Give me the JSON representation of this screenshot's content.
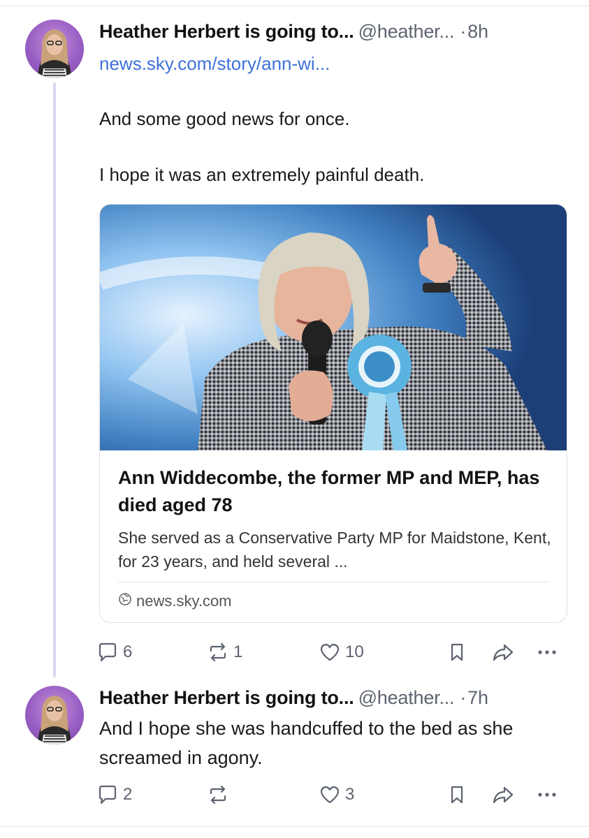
{
  "post1": {
    "author": "Heather Herbert is going to...",
    "handle": "@heather...",
    "separator": "·",
    "time": "8h",
    "link": "news.sky.com/story/ann-wi...",
    "text_line1": "And some good news for once.",
    "text_line2": "I hope it was an extremely painful death.",
    "card": {
      "title": "Ann Widdecombe, the former MP and MEP, has died aged 78",
      "description": "She served as a Conservative Party MP for Maidstone, Kent, for 23 years, and held several ...",
      "domain": "news.sky.com"
    },
    "replies": "6",
    "reposts": "1",
    "likes": "10"
  },
  "post2": {
    "author": "Heather Herbert is going to...",
    "handle": "@heather...",
    "separator": "·",
    "time": "7h",
    "text": "And I hope she was handcuffed to the bed as she screamed in agony.",
    "replies": "2",
    "reposts": "",
    "likes": "3"
  },
  "icons": {
    "reply": "speech-bubble-icon",
    "repost": "repost-arrows-icon",
    "like": "heart-icon",
    "bookmark": "bookmark-icon",
    "share": "share-arrow-icon",
    "more": "ellipsis-icon",
    "globe": "globe-icon"
  },
  "colors": {
    "link": "#3f72d8",
    "muted": "#5d6470",
    "thread_line": "#d9d6f0"
  }
}
